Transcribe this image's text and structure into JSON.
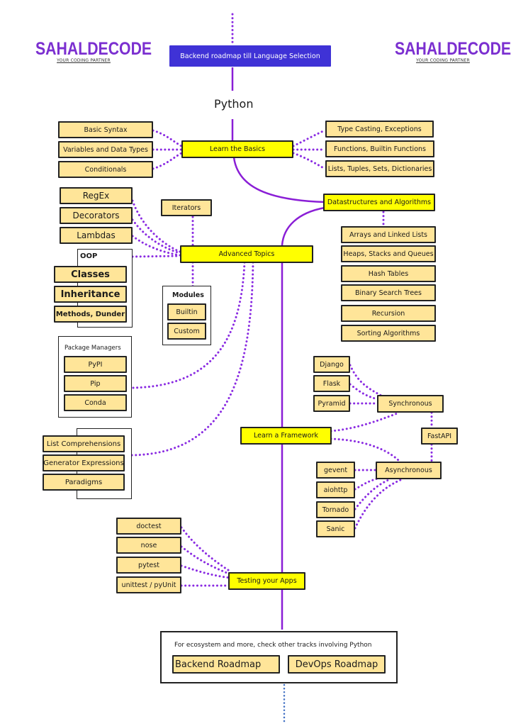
{
  "colors": {
    "topic_fill": "#ffe599",
    "main_fill": "#ffff00",
    "header_fill": "#3f32d6",
    "line_purple": "#8a1ed6",
    "dots_purple": "#8a2be2",
    "dots_blue": "#4472c4",
    "brand_purple": "#7b2fd0"
  },
  "logo_left": {
    "name": "SAHALDECODE",
    "tagline": "YOUR CODING PARTNER"
  },
  "logo_right": {
    "name": "SAHALDECODE",
    "tagline": "YOUR CODING PARTNER"
  },
  "header": {
    "title": "Backend roadmap till Language Selection"
  },
  "root": {
    "label": "Python"
  },
  "basics": {
    "label": "Learn the Basics",
    "left": [
      "Basic Syntax",
      "Variables and Data Types",
      "Conditionals"
    ],
    "right": [
      "Type Casting, Exceptions",
      "Functions, Builtin Functions",
      "Lists, Tuples, Sets, Dictionaries"
    ]
  },
  "dsa": {
    "label": "Datastructures and Algorithms",
    "items": [
      "Arrays and Linked Lists",
      "Heaps, Stacks and Queues",
      "Hash Tables",
      "Binary Search Trees",
      "Recursion",
      "Sorting Algorithms"
    ]
  },
  "advanced": {
    "label": "Advanced Topics",
    "left": [
      "RegEx",
      "Decorators",
      "Lambdas"
    ],
    "iterators": "Iterators",
    "oop": {
      "title": "OOP",
      "items": [
        "Classes",
        "Inheritance",
        "Methods, Dunder"
      ]
    },
    "modules": {
      "title": "Modules",
      "items": [
        "Builtin",
        "Custom"
      ]
    },
    "package_managers": {
      "title": "Package Managers",
      "items": [
        "PyPI",
        "Pip",
        "Conda"
      ]
    },
    "misc": [
      "List Comprehensions",
      "Generator Expressions",
      "Paradigms"
    ]
  },
  "framework": {
    "label": "Learn a Framework",
    "synchronous": {
      "label": "Synchronous",
      "items": [
        "Django",
        "Flask",
        "Pyramid"
      ]
    },
    "fastapi": "FastAPI",
    "asynchronous": {
      "label": "Asynchronous",
      "items": [
        "gevent",
        "aiohttp",
        "Tornado",
        "Sanic"
      ]
    }
  },
  "testing": {
    "label": "Testing your Apps",
    "items": [
      "doctest",
      "nose",
      "pytest",
      "unittest / pyUnit"
    ]
  },
  "footer": {
    "text": "For ecosystem and more, check other tracks involving Python",
    "links": [
      "Backend Roadmap",
      "DevOps Roadmap"
    ]
  }
}
